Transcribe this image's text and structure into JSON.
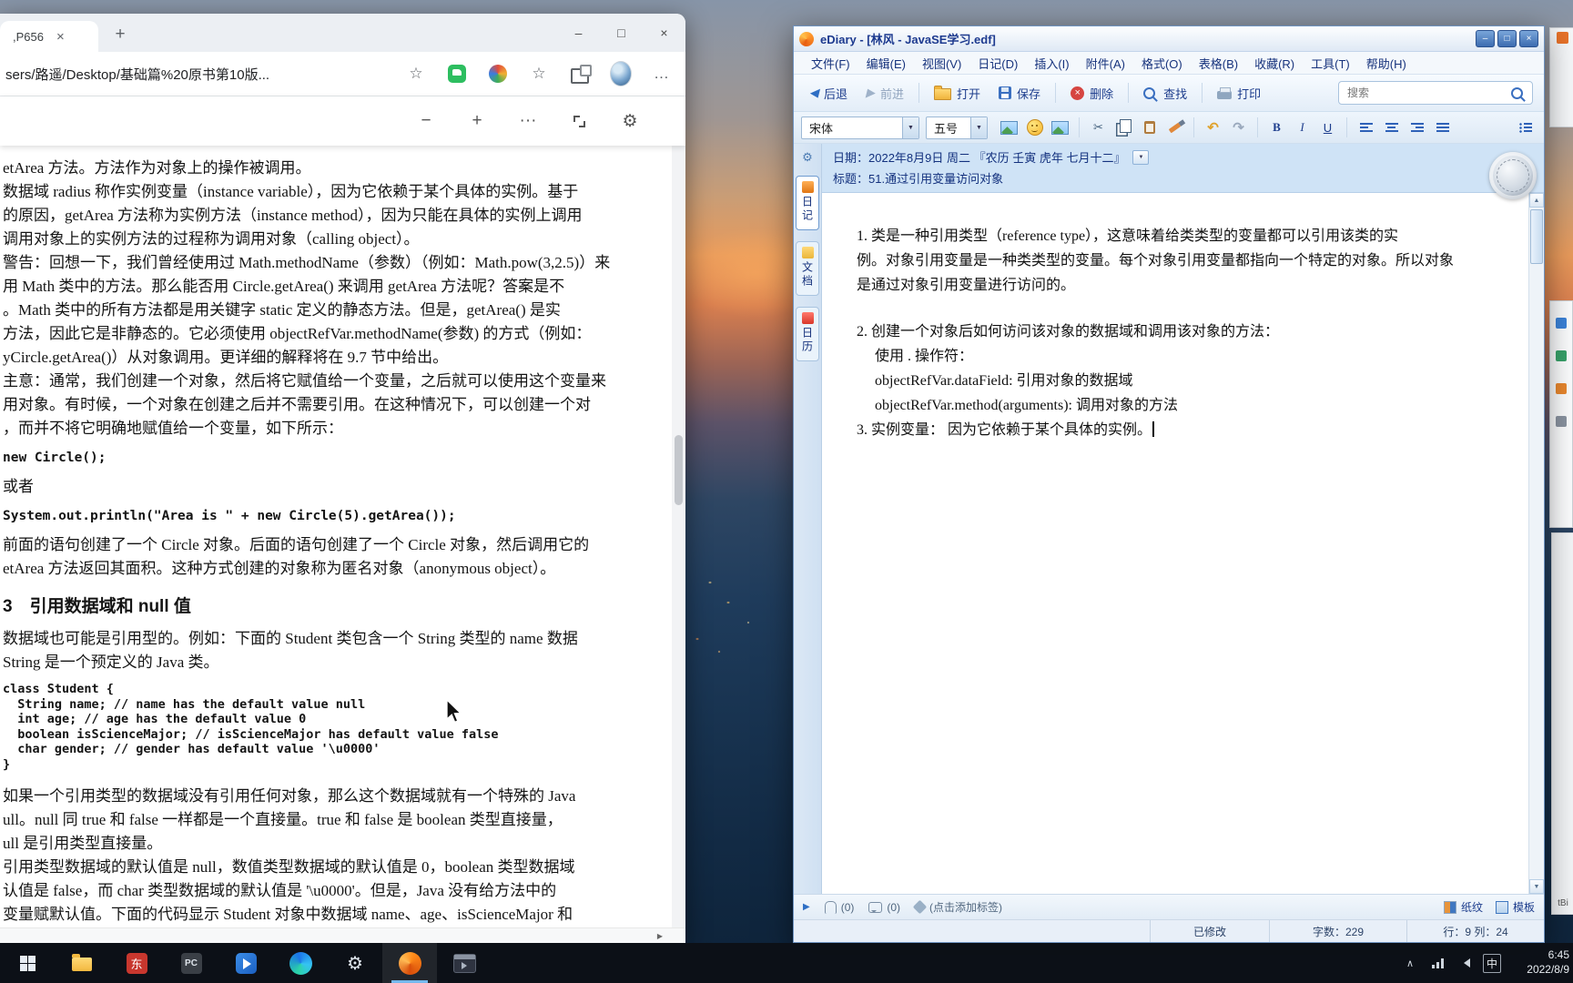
{
  "icons": {
    "tab_close": "×",
    "new_tab": "+",
    "win_min": "–",
    "win_max": "□",
    "win_close": "×",
    "pdf_zoom_out": "−",
    "pdf_zoom_in": "+",
    "pdf_more": "···",
    "pdf_settings": "⚙",
    "star_add": "☆",
    "star": "☆",
    "more_menu": "…",
    "scroll_up": "▲",
    "scroll_down": "▼",
    "scroll_right": "▶",
    "back_arrow": "◀",
    "forward_arrow": "▶",
    "dropdown": "▼",
    "undo": "↶",
    "redo": "↷",
    "expand_right": "▶",
    "gear": "⚙",
    "cut": "✂",
    "tray_chevron": "∧"
  },
  "browser": {
    "tab_title": ",P656",
    "address": "sers/路遥/Desktop/基础篇%20原书第10版...",
    "pdf_blocks": [
      {
        "type": "p",
        "lines": [
          "etArea 方法。方法作为对象上的操作被调用。"
        ]
      },
      {
        "type": "p",
        "lines": [
          "数据域 radius 称作实例变量（instance variable），因为它依赖于某个具体的实例。基于",
          "的原因，getArea 方法称为实例方法（instance method），因为只能在具体的实例上调用",
          "调用对象上的实例方法的过程称为调用对象（calling object）。"
        ]
      },
      {
        "type": "p",
        "lines": [
          "警告：回想一下，我们曾经使用过 Math.methodName（参数）（例如：Math.pow(3,2.5)）来",
          "用 Math 类中的方法。那么能否用 Circle.getArea() 来调用 getArea 方法呢？答案是不",
          "。Math 类中的所有方法都是用关键字 static 定义的静态方法。但是，getArea() 是实",
          "方法，因此它是非静态的。它必须使用 objectRefVar.methodName(参数) 的方式（例如：",
          "yCircle.getArea()）从对象调用。更详细的解释将在 9.7 节中给出。"
        ]
      },
      {
        "type": "p",
        "lines": [
          "主意：通常，我们创建一个对象，然后将它赋值给一个变量，之后就可以使用这个变量来",
          "用对象。有时候，一个对象在创建之后并不需要引用。在这种情况下，可以创建一个对",
          "，而并不将它明确地赋值给一个变量，如下所示："
        ]
      },
      {
        "type": "code",
        "lines": [
          "new Circle();"
        ]
      },
      {
        "type": "p",
        "lines": [
          "或者"
        ]
      },
      {
        "type": "code",
        "lines": [
          "System.out.println(\"Area is \" + new Circle(5).getArea());"
        ]
      },
      {
        "type": "p",
        "lines": [
          "前面的语句创建了一个 Circle 对象。后面的语句创建了一个 Circle 对象，然后调用它的",
          "etArea 方法返回其面积。这种方式创建的对象称为匿名对象（anonymous object）。"
        ]
      },
      {
        "type": "h",
        "lines": [
          "3　引用数据域和 null 值"
        ]
      },
      {
        "type": "p",
        "lines": [
          "数据域也可能是引用型的。例如：下面的 Student 类包含一个 String 类型的 name 数据",
          "String 是一个预定义的 Java 类。"
        ]
      },
      {
        "type": "codeblock",
        "lines": [
          "class Student {",
          "  String name; // name has the default value null",
          "  int age; // age has the default value 0",
          "  boolean isScienceMajor; // isScienceMajor has default value false",
          "  char gender; // gender has default value '\\u0000'",
          "}"
        ]
      },
      {
        "type": "p",
        "lines": [
          "如果一个引用类型的数据域没有引用任何对象，那么这个数据域就有一个特殊的 Java",
          "ull。null 同 true 和 false 一样都是一个直接量。true 和 false 是 boolean 类型直接量，",
          "ull 是引用类型直接量。"
        ]
      },
      {
        "type": "p",
        "lines": [
          "引用类型数据域的默认值是 null，数值类型数据域的默认值是 0，boolean 类型数据域",
          "认值是 false，而 char 类型数据域的默认值是 '\\u0000'。但是，Java 没有给方法中的",
          "变量赋默认值。下面的代码显示 Student 对象中数据域 name、age、isScienceMajor 和"
        ]
      }
    ]
  },
  "ediary": {
    "title": "eDiary - [林风 - JavaSE学习.edf]",
    "menu": [
      "文件(F)",
      "编辑(E)",
      "视图(V)",
      "日记(D)",
      "插入(I)",
      "附件(A)",
      "格式(O)",
      "表格(B)",
      "收藏(R)",
      "工具(T)",
      "帮助(H)"
    ],
    "toolbar": {
      "back": "后退",
      "forward": "前进",
      "open": "打开",
      "save": "保存",
      "delete": "删除",
      "find": "查找",
      "print": "打印",
      "search_placeholder": "搜索"
    },
    "format": {
      "font": "宋体",
      "size": "五号",
      "bold": "B",
      "italic": "I",
      "underline": "U"
    },
    "date_label": "日期：2022年8月9日 周二 『农历 壬寅 虎年 七月十二』",
    "title_label": "标题：51.通过引用变量访问对象",
    "sidebar": {
      "tab1": "日记",
      "tab2": "文档",
      "tab3": "日历"
    },
    "content_blocks": [
      {
        "lines": [
          "1. 类是一种引用类型（reference type），这意味着给类类型的变量都可以引用该类的实",
          "例。对象引用变量是一种类类型的变量。每个对象引用变量都指向一个特定的对象。所以对象",
          "是通过对象引用变量进行访问的。"
        ]
      },
      {
        "lines": [
          "2. 创建一个对象后如何访问该对象的数据域和调用该对象的方法：",
          "　 使用 . 操作符：",
          "　 objectRefVar.dataField: 引用对象的数据域",
          "　 objectRefVar.method(arguments): 调用对象的方法",
          "3. 实例变量： 因为它依赖于某个具体的实例。"
        ],
        "caret": true
      }
    ],
    "attachbar": {
      "attach_count": "(0)",
      "comment_count": "(0)",
      "tags": "(点击添加标签)",
      "paper": "纸纹",
      "template": "模板"
    },
    "status": {
      "modified": "已修改",
      "words": "字数：229",
      "rowcol": "行：9 列：24"
    }
  },
  "taskbar": {
    "app2_label": "东",
    "app3_label": "PC",
    "ime": "中",
    "time": "6:45",
    "date": "2022/8/9"
  },
  "edge_panel_fragment": "tBi"
}
